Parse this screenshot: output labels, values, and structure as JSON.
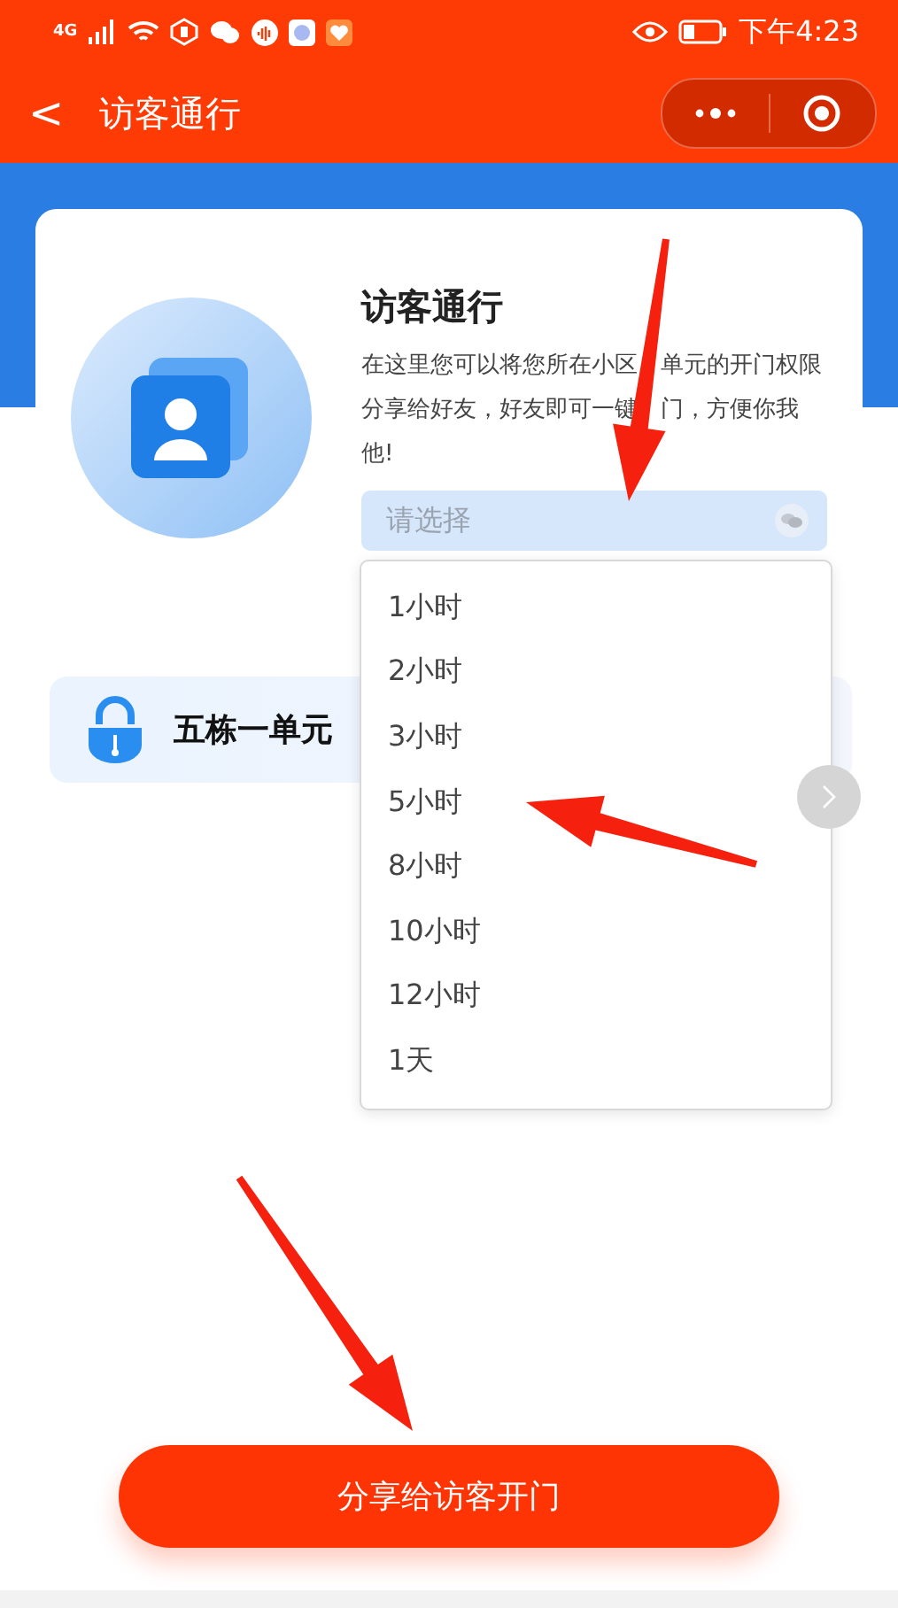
{
  "status_bar": {
    "network": "4G",
    "time": "下午4:23"
  },
  "nav_bar": {
    "back": "<",
    "title": "访客通行"
  },
  "intro": {
    "title": "访客通行",
    "description_lines": [
      [
        "在这里您可以将您所在小区",
        "单元的开门权限"
      ],
      [
        "分享给好友，好友即可一键",
        "门，方便你我"
      ],
      [
        "他!"
      ]
    ]
  },
  "duration_select": {
    "placeholder": "请选择",
    "expanded": true,
    "options": [
      {
        "label": "1小时",
        "selected": false
      },
      {
        "label": "2小时",
        "selected": false
      },
      {
        "label": "3小时",
        "selected": false
      },
      {
        "label": "5小时",
        "selected": false
      },
      {
        "label": "8小时",
        "selected": false
      },
      {
        "label": "10小时",
        "selected": false
      },
      {
        "label": "12小时",
        "selected": false
      },
      {
        "label": "1天",
        "selected": false
      }
    ]
  },
  "unit": {
    "name": "五栋一单元"
  },
  "share_button": {
    "label": "分享给访客开门"
  }
}
